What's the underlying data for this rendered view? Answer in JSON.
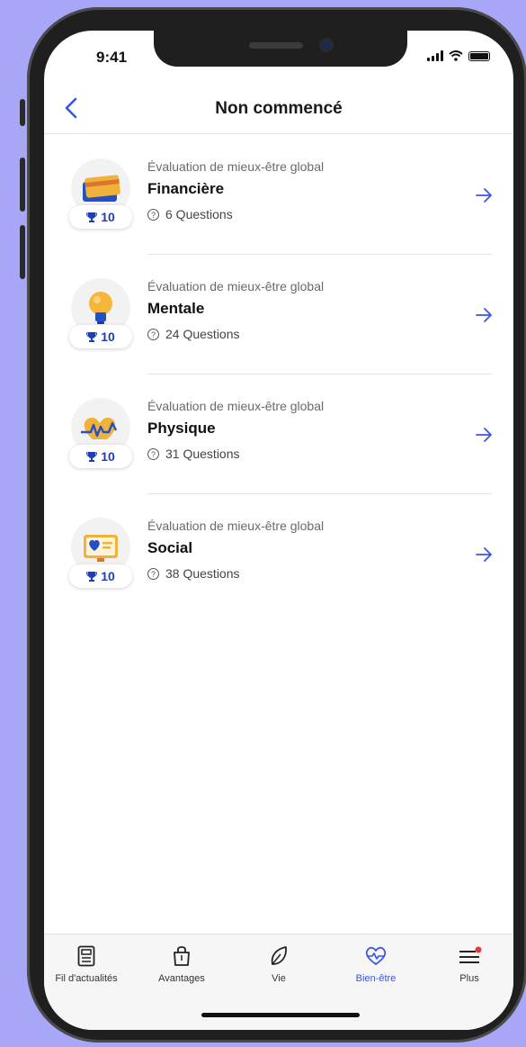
{
  "status": {
    "time": "9:41"
  },
  "nav": {
    "title": "Non commencé"
  },
  "items": [
    {
      "category": "Évaluation de mieux-être global",
      "name": "Financière",
      "points": "10",
      "questions": "6 Questions",
      "icon": "credit-card-icon"
    },
    {
      "category": "Évaluation de mieux-être global",
      "name": "Mentale",
      "points": "10",
      "questions": "24 Questions",
      "icon": "lightbulb-icon"
    },
    {
      "category": "Évaluation de mieux-être global",
      "name": "Physique",
      "points": "10",
      "questions": "31 Questions",
      "icon": "heartbeat-icon"
    },
    {
      "category": "Évaluation de mieux-être global",
      "name": "Social",
      "points": "10",
      "questions": "38 Questions",
      "icon": "heart-card-icon"
    }
  ],
  "tabs": [
    {
      "label": "Fil d'actualités",
      "icon": "newsfeed-icon"
    },
    {
      "label": "Avantages",
      "icon": "shopping-bag-icon"
    },
    {
      "label": "Vie",
      "icon": "leaf-icon"
    },
    {
      "label": "Bien-être",
      "icon": "heart-pulse-icon",
      "active": true
    },
    {
      "label": "Plus",
      "icon": "menu-icon"
    }
  ],
  "colors": {
    "accent": "#3a55e3",
    "background": "#a8a6f7",
    "trophy": "#1c3fb8"
  }
}
